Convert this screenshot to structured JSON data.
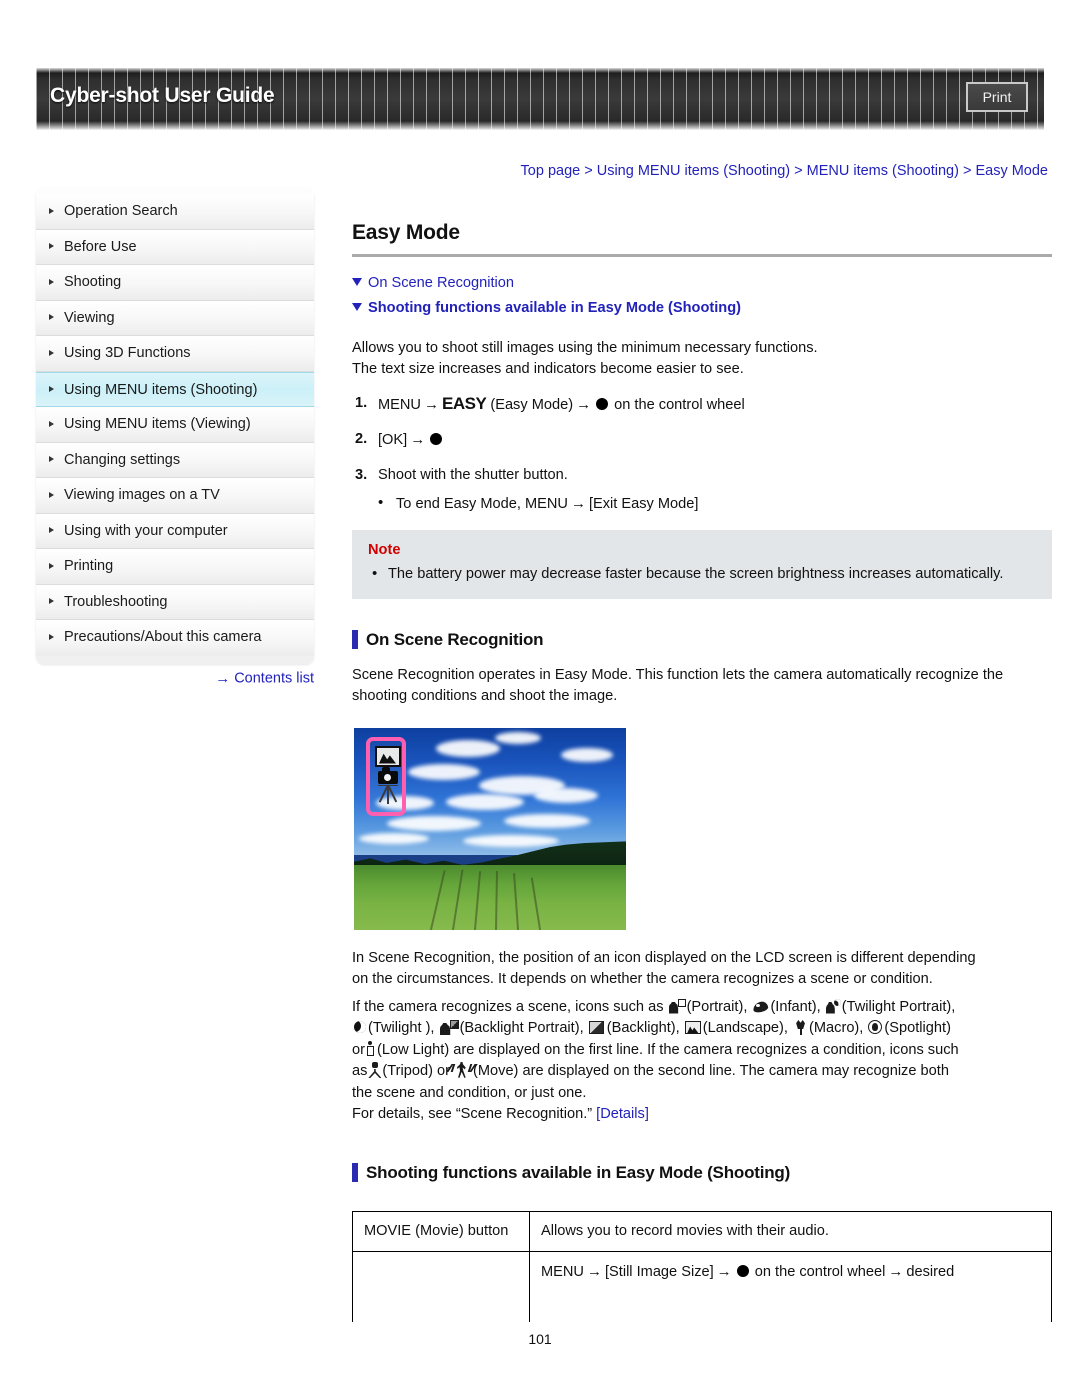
{
  "header": {
    "title": "Cyber-shot User Guide",
    "print_label": "Print"
  },
  "breadcrumb": {
    "text": "Top page > Using MENU items (Shooting) > MENU items (Shooting) > Easy Mode"
  },
  "sidebar": {
    "items": [
      {
        "label": "Operation Search",
        "active": false
      },
      {
        "label": "Before Use",
        "active": false
      },
      {
        "label": "Shooting",
        "active": false
      },
      {
        "label": "Viewing",
        "active": false
      },
      {
        "label": "Using 3D Functions",
        "active": false
      },
      {
        "label": "Using MENU items (Shooting)",
        "active": true
      },
      {
        "label": "Using MENU items (Viewing)",
        "active": false
      },
      {
        "label": "Changing settings",
        "active": false
      },
      {
        "label": "Viewing images on a TV",
        "active": false
      },
      {
        "label": "Using with your computer",
        "active": false
      },
      {
        "label": "Printing",
        "active": false
      },
      {
        "label": "Troubleshooting",
        "active": false
      },
      {
        "label": "Precautions/About this camera",
        "active": false
      }
    ],
    "contents_link": "Contents list",
    "contents_arrow": "→"
  },
  "main": {
    "page_title": "Easy Mode",
    "jump_links": [
      "On Scene Recognition",
      "Shooting functions available in Easy Mode (Shooting)"
    ],
    "intro_line1": "Allows you to shoot still images using the minimum necessary functions.",
    "intro_line2": "The text size increases and indicators become easier to see.",
    "steps": [
      {
        "num": "1.",
        "pre": "MENU",
        "arrow1": "→",
        "logo": "EASY",
        "mid": "(Easy Mode)",
        "arrow2": "→",
        "post": "on the control wheel"
      },
      {
        "num": "2.",
        "pre": "[OK]",
        "arrow1": "→"
      },
      {
        "num": "3.",
        "pre": "Shoot with the shutter button.",
        "sub_pre": "To end Easy Mode, MENU",
        "sub_arrow": "→",
        "sub_post": "[Exit Easy Mode]"
      }
    ],
    "note": {
      "label": "Note",
      "item": "The battery power may decrease faster because the screen brightness increases automatically."
    },
    "section1": {
      "heading": "On Scene Recognition",
      "para1": "Scene Recognition operates in Easy Mode. This function lets the camera automatically recognize the shooting conditions and shoot the image.",
      "photo_alt": "Camera LCD preview showing a landscape with scene recognition icons highlighted",
      "para2_l1": "In Scene Recognition, the position of an icon displayed on the LCD screen is different depending",
      "para2_l2": "on the circumstances. It depends on whether the camera recognizes a scene or condition.",
      "icon_intro": "If the camera recognizes a scene, icons such as",
      "icon_labels": {
        "portrait": "(Portrait),",
        "infant": "(Infant),",
        "twilight_portrait": "(Twilight Portrait),",
        "twilight": "(Twilight ),",
        "backlight_portrait": "(Backlight Portrait),",
        "backlight": "(Backlight),",
        "landscape": "(Landscape),",
        "macro": "(Macro),",
        "spotlight": "(Spotlight)",
        "low_light": "(Low Light)",
        "tripod": "(Tripod)",
        "move": "(Move)"
      },
      "text_or": "or",
      "text_firstline": "are displayed on the first line. If the camera recognizes a condition, icons such",
      "text_as": "as",
      "text_or2": "or",
      "text_secondline": "are displayed on the second line. The camera may recognize both",
      "text_l4": "the scene and condition, or just one.",
      "details_pre": "For details, see “Scene Recognition.”",
      "details_link": "[Details]"
    },
    "section2": {
      "heading": "Shooting functions available in Easy Mode (Shooting)",
      "table": {
        "rows": [
          {
            "c1": "MOVIE (Movie) button",
            "c2": "Allows you to record movies with their audio."
          },
          {
            "c1": "",
            "c2_pre": "MENU",
            "c2_a1": "→",
            "c2_m1": "[Still Image Size]",
            "c2_a2": "→",
            "c2_m2": "on the control wheel",
            "c2_a3": "→",
            "c2_post": "desired"
          }
        ]
      }
    }
  },
  "footer": {
    "page_number": "101"
  }
}
